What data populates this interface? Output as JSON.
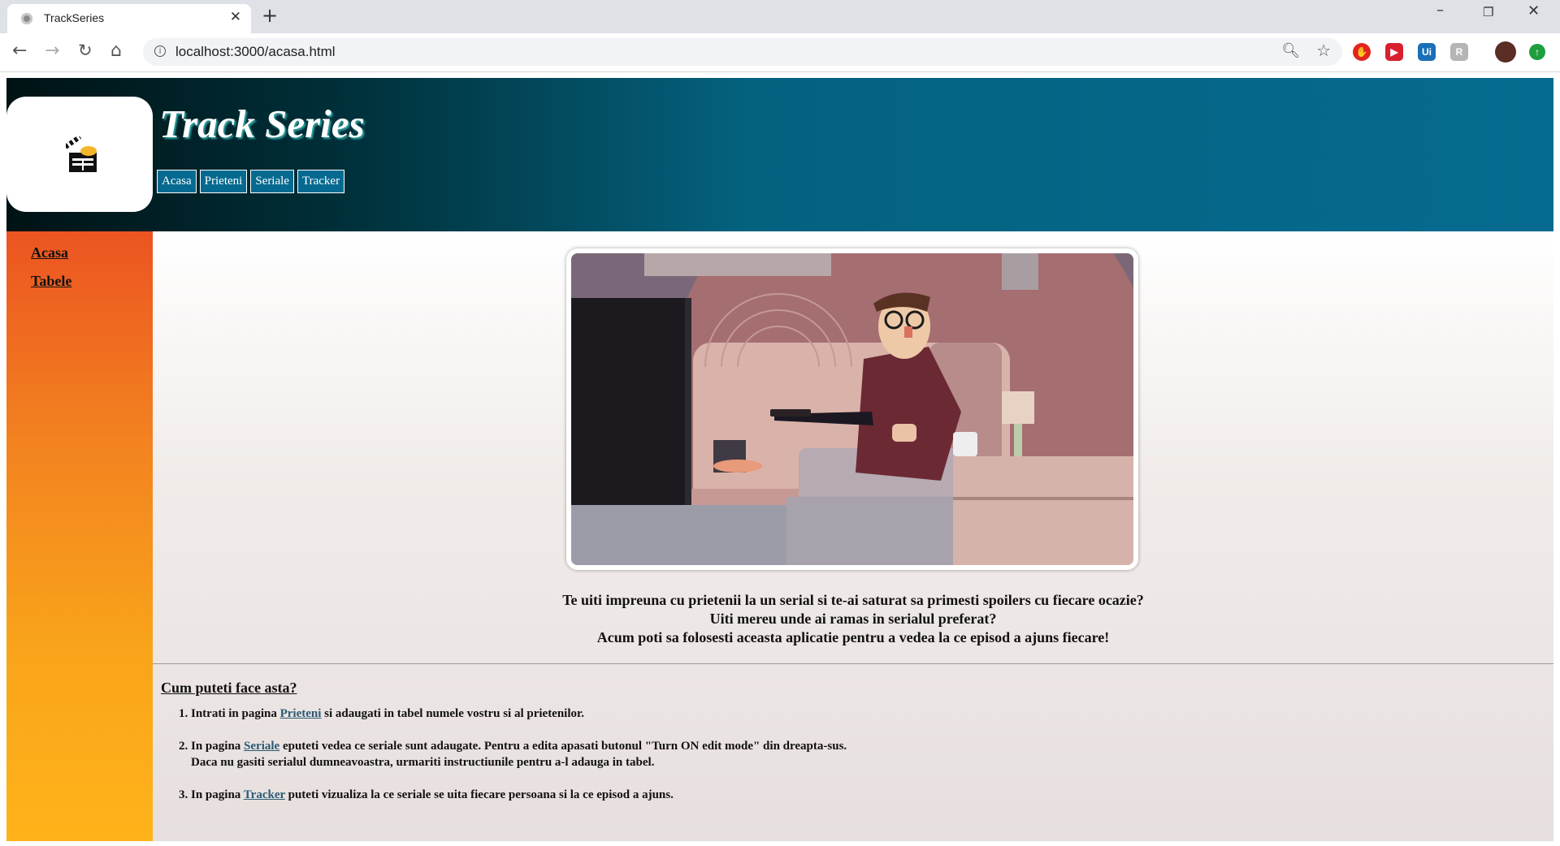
{
  "browser": {
    "tab_title": "TrackSeries",
    "url": "localhost:3000/acasa.html",
    "extensions": [
      {
        "name": "adblock-icon",
        "color": "#e3231e",
        "glyph": "⬤"
      },
      {
        "name": "video-extension-icon",
        "color": "#d8202f",
        "glyph": "▶"
      },
      {
        "name": "uipath-icon",
        "color": "#1a6fb8",
        "glyph": "Ui"
      },
      {
        "name": "gray-extension-icon",
        "color": "#b0b0b0",
        "glyph": "R"
      },
      {
        "name": "update-icon",
        "color": "#1e9e3d",
        "glyph": "↑"
      }
    ]
  },
  "header": {
    "title": "Track Series",
    "nav": [
      "Acasa",
      "Prieteni",
      "Seriale",
      "Tracker"
    ]
  },
  "sidebar": {
    "links": [
      "Acasa",
      "Tabele"
    ]
  },
  "intro": {
    "line1": "Te uiti impreuna cu prietenii la un serial si te-ai saturat sa primesti spoilers cu fiecare ocazie?",
    "line2": "Uiti mereu unde ai ramas in serialul preferat?",
    "line3": "Acum poti sa folosesti aceasta aplicatie pentru a vedea la ce episod a ajuns fiecare!"
  },
  "how": {
    "title": "Cum puteti face asta?",
    "step1": {
      "before": "Intrati in pagina ",
      "link": "Prieteni",
      "after": " si adaugati in tabel numele vostru si al prietenilor."
    },
    "step2": {
      "before": "In pagina ",
      "link": "Seriale",
      "after": " eputeti vedea ce seriale sunt adaugate. Pentru a edita apasati butonul \"Turn ON edit mode\" din dreapta-sus.",
      "line2": "Daca nu gasiti serialul dumneavoastra, urmariti instructiunile pentru a-l adauga in tabel."
    },
    "step3": {
      "before": "In pagina ",
      "link": "Tracker",
      "after": " puteti vizualiza la ce seriale se uita fiecare persoana si la ce episod a ajuns."
    }
  }
}
